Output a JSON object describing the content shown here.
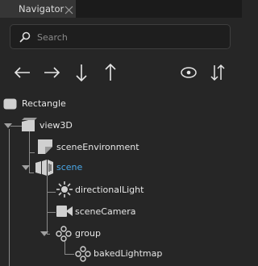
{
  "tab": {
    "title": "Navigator"
  },
  "search": {
    "placeholder": "Search",
    "value": ""
  },
  "toolbar": {
    "items": [
      {
        "name": "arrow-left-icon"
      },
      {
        "name": "arrow-right-icon"
      },
      {
        "name": "arrow-down-icon"
      },
      {
        "name": "arrow-up-icon"
      },
      {
        "name": "eye-icon"
      },
      {
        "name": "sort-icon"
      }
    ]
  },
  "tree": {
    "nodes": [
      {
        "label": "Rectangle",
        "icon": "rectangle-icon",
        "expanded": null,
        "selected": false
      },
      {
        "label": "view3D",
        "icon": "view3d-icon",
        "expanded": true,
        "selected": false
      },
      {
        "label": "sceneEnvironment",
        "icon": "scene-environment-icon",
        "expanded": null,
        "selected": false
      },
      {
        "label": "scene",
        "icon": "scene-icon",
        "expanded": true,
        "selected": true
      },
      {
        "label": "directionalLight",
        "icon": "light-icon",
        "expanded": null,
        "selected": false
      },
      {
        "label": "sceneCamera",
        "icon": "camera-icon",
        "expanded": null,
        "selected": false
      },
      {
        "label": "group",
        "icon": "group-icon",
        "expanded": true,
        "selected": false
      },
      {
        "label": "bakedLightmap",
        "icon": "group-icon",
        "expanded": null,
        "selected": false
      }
    ]
  },
  "colors": {
    "background": "#262626",
    "tab_background": "#363636",
    "text": "#e6e6e6",
    "selected_text": "#4aa8e8",
    "tree_lines": "#8a8a8a"
  }
}
